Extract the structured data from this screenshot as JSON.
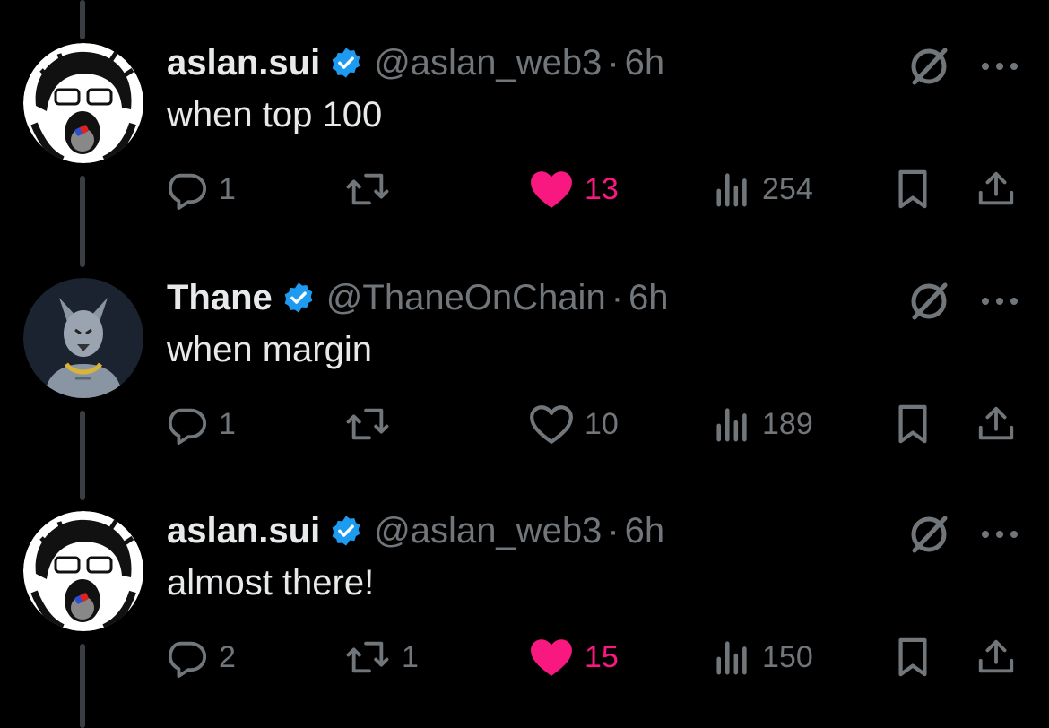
{
  "tweets": [
    {
      "author": {
        "name": "aslan.sui",
        "handle": "@aslan_web3",
        "avatar": "aslan-avatar"
      },
      "time": "6h",
      "text": "when top 100",
      "reply_count": "1",
      "retweet_count": "",
      "like_count": "13",
      "liked": true,
      "view_count": "254"
    },
    {
      "author": {
        "name": "Thane",
        "handle": "@ThaneOnChain",
        "avatar": "thane-avatar"
      },
      "time": "6h",
      "text": "when margin",
      "reply_count": "1",
      "retweet_count": "",
      "like_count": "10",
      "liked": false,
      "view_count": "189"
    },
    {
      "author": {
        "name": "aslan.sui",
        "handle": "@aslan_web3",
        "avatar": "aslan-avatar"
      },
      "time": "6h",
      "text": "almost there!",
      "reply_count": "2",
      "retweet_count": "1",
      "like_count": "15",
      "liked": true,
      "view_count": "150"
    }
  ],
  "separator": "·",
  "icons": {
    "verified": "verified-badge-icon",
    "grok": "grok-icon",
    "more": "more-options-icon",
    "reply": "reply-icon",
    "retweet": "retweet-icon",
    "like": "heart-icon",
    "views": "views-icon",
    "bookmark": "bookmark-icon",
    "share": "share-icon"
  },
  "colors": {
    "background": "#000000",
    "text": "#e7e9ea",
    "muted": "#71767b",
    "like": "#f91880",
    "verified": "#1d9bf0",
    "thread_line": "#3a3d42"
  }
}
